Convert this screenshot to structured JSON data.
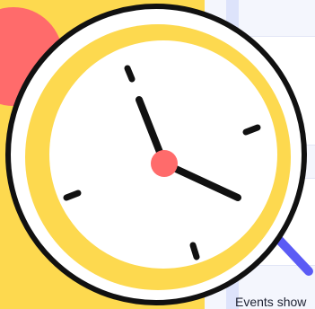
{
  "page": {
    "footer_text": "Events show"
  },
  "clock": {
    "icon": "clock-icon"
  },
  "colors": {
    "yellow": "#fdd94f",
    "pink": "#ff6b6b",
    "lavender": "#dde3fb",
    "blue": "#5b5bf5",
    "outline": "#111111"
  }
}
